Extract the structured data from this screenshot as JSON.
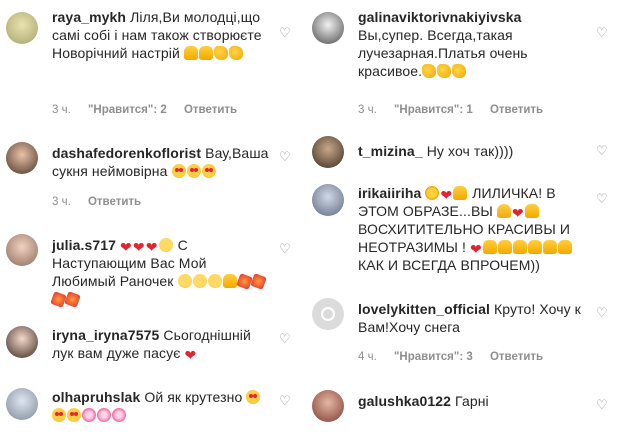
{
  "left": [
    {
      "user": "raya_mykh",
      "text": "Ліля,Ви молодці,що самі собі і нам також створюєте Новорічний настрій",
      "emojis": [
        "thumb",
        "thumb",
        "clap",
        "clap"
      ],
      "time": "3 ч.",
      "likes": "\"Нравится\": 2",
      "reply": "Ответить"
    },
    {
      "user": "dashafedorenkoflorist",
      "text": "Вау,Ваша сукня неймовірна",
      "emojis": [
        "love",
        "love",
        "love"
      ],
      "time": "3 ч.",
      "likes": "",
      "reply": "Ответить"
    },
    {
      "user": "julia.s717",
      "text": "С Наступающим Вас Мой Любимый Раночек",
      "emojis_before": [
        "heart",
        "heart",
        "heart",
        "smile"
      ],
      "emojis": [
        "smile",
        "smile",
        "smile",
        "thumb",
        "boom",
        "boom",
        "boom",
        "boom"
      ],
      "time": "",
      "likes": "",
      "reply": ""
    },
    {
      "user": "iryna_iryna7575",
      "text": "Сьогоднішній лук вам дуже пасує",
      "emojis": [
        "heart"
      ],
      "time": "",
      "likes": "",
      "reply": ""
    },
    {
      "user": "olhapruhslak",
      "text": "Ой як крутезно",
      "emojis": [
        "love",
        "love",
        "love",
        "flower",
        "flower",
        "flower"
      ],
      "time": "",
      "likes": "",
      "reply": ""
    }
  ],
  "right": [
    {
      "user": "galinaviktorivnakiyivska",
      "text": "Вы,супер. Всегда,такая лучезарная.Платья очень красивое.",
      "emojis": [
        "clap",
        "clap",
        "clap"
      ],
      "time": "3 ч.",
      "likes": "\"Нравится\": 1",
      "reply": "Ответить"
    },
    {
      "user": "t_mizina_",
      "text": "Ну хоч так))))",
      "emojis": [],
      "time": "",
      "likes": "",
      "reply": ""
    },
    {
      "user": "irikaiiriha",
      "text_a": "ЛИЛИЧКА! В ЭТОМ ОБРАЗЕ...ВЫ",
      "text_b": "ВОСХИТИТЕЛЬНО КРАСИВЫ И НЕОТРАЗИМЫ !",
      "text_c": "КАК И ВСЕГДА ВПРОЧЕМ))",
      "time": "",
      "likes": "",
      "reply": ""
    },
    {
      "user": "lovelykitten_official",
      "text": "Круто! Хочу к Вам!Хочу снега",
      "emojis": [],
      "time": "4 ч.",
      "likes": "\"Нравится\": 3",
      "reply": "Ответить"
    },
    {
      "user": "galushka0122",
      "text": "Гарні",
      "emojis": [],
      "time": "",
      "likes": "",
      "reply": ""
    }
  ],
  "colors": {
    "text": "#262626",
    "meta": "#8e8e8e",
    "heart": "#e0252f"
  },
  "icons": {
    "like": "heart-outline-icon"
  }
}
